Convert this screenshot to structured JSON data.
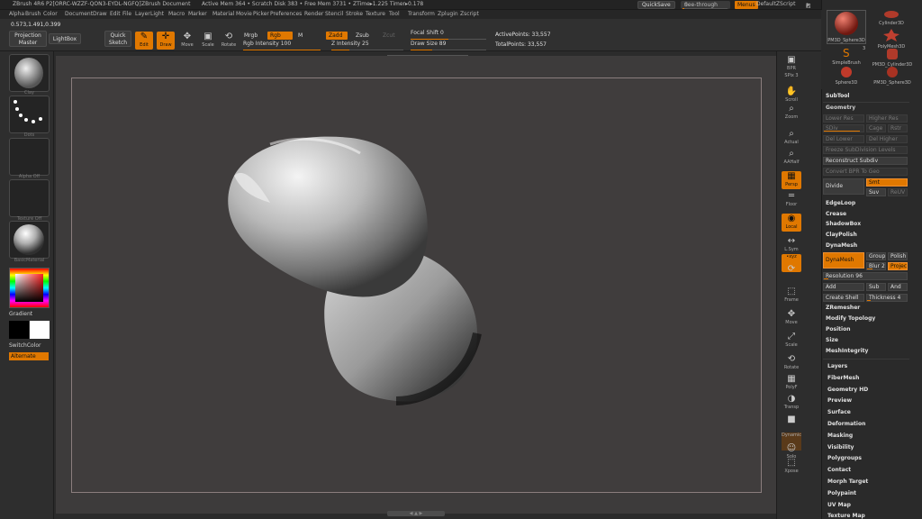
{
  "title": {
    "app": "ZBrush 4R6 P2[ORRC-WZZF-QON3-EYDL-NGFQ]",
    "doc": "ZBrush Document",
    "mem": "Active Mem 364 • Scratch Disk 383 • Free Mem 3731 • ZTime▸1.225 Timer▸0.178",
    "quicksave": "QuickSave",
    "seethrough": "See-through",
    "seethrough_value": "0",
    "seethrough_fraction": 0.0,
    "menus": "Menus",
    "script": "DefaultZScript"
  },
  "menubar": [
    "Alpha",
    "Brush",
    "Color",
    "Document",
    "Draw",
    "Edit",
    "File",
    "Layer",
    "Light",
    "Macro",
    "Marker",
    "Material",
    "Movie",
    "Picker",
    "Preferences",
    "Render",
    "Stencil",
    "Stroke",
    "Texture",
    "Tool",
    "Transform",
    "Zplugin",
    "Zscript"
  ],
  "topshelf": {
    "coords": "0.573,1.491,0.399",
    "projection_master": "Projection Master",
    "lightbox": "LightBox",
    "quick_sketch": "Quick Sketch",
    "edit": "Edit",
    "draw": "Draw",
    "move": "Move",
    "scale": "Scale",
    "rotate": "Rotate",
    "mrgb": "Mrgb",
    "rgb": "Rgb",
    "m": "M",
    "rgb_intensity_label": "Rgb Intensity 100",
    "rgb_intensity": 100,
    "zadd": "Zadd",
    "zsub": "Zsub",
    "zcut": "Zcut",
    "z_intensity_label": "Z Intensity 25",
    "z_intensity": 25,
    "focal_shift_label": "Focal Shift 0",
    "focal_shift": 0,
    "draw_size_label": "Draw Size 89",
    "draw_size": 89,
    "active_points": "ActivePoints: 33,557",
    "total_points": "TotalPoints: 33,557"
  },
  "leftshelf": {
    "thumb_labels": [
      "Clay",
      "Dots",
      "Alpha Off",
      "Texture Off",
      "BasicMaterial"
    ],
    "gradient": "Gradient",
    "switchcolor": "SwitchColor",
    "alternate": "Alternate",
    "main_color": "#000000",
    "secondary_color": "#ffffff"
  },
  "rightshelf": [
    {
      "name": "bpr",
      "label": "BPR",
      "glyph": "▣"
    },
    {
      "name": "spix",
      "label": "SPix 3",
      "glyph": ""
    },
    {
      "name": "scroll",
      "label": "Scroll",
      "glyph": "✋"
    },
    {
      "name": "zoom",
      "label": "Zoom",
      "glyph": "⌕"
    },
    {
      "name": "actual",
      "label": "Actual",
      "glyph": "⌕"
    },
    {
      "name": "aahalf",
      "label": "AAHalf",
      "glyph": "⌕"
    },
    {
      "name": "persp",
      "label": "Persp",
      "glyph": "▦"
    },
    {
      "name": "floor",
      "label": "Floor",
      "glyph": "═"
    },
    {
      "name": "local",
      "label": "Local",
      "glyph": "◉"
    },
    {
      "name": "lsym",
      "label": "L.Sym",
      "glyph": "↔"
    },
    {
      "name": "xyz",
      "label": "•xyz",
      "glyph": ""
    },
    {
      "name": "rotate-y",
      "label": "",
      "glyph": "⟳"
    },
    {
      "name": "frame",
      "label": "Frame",
      "glyph": "⬚"
    },
    {
      "name": "move",
      "label": "Move",
      "glyph": "✥"
    },
    {
      "name": "scale",
      "label": "Scale",
      "glyph": "⤢"
    },
    {
      "name": "rotate",
      "label": "Rotate",
      "glyph": "⟲"
    },
    {
      "name": "polyf",
      "label": "PolyF",
      "glyph": "▦"
    },
    {
      "name": "transp",
      "label": "Transp",
      "glyph": "◑"
    },
    {
      "name": "ghost",
      "label": "",
      "glyph": "■"
    },
    {
      "name": "dynamic",
      "label": "Dynamic",
      "glyph": ""
    },
    {
      "name": "solo",
      "label": "Solo",
      "glyph": "☺"
    },
    {
      "name": "xpose",
      "label": "Xpose",
      "glyph": "⬚"
    }
  ],
  "tray": {
    "tool_thumbs": [
      {
        "label": "PM3D_Sphere3D"
      },
      {
        "label": "Cylinder3D"
      },
      {
        "label": "PolyMesh3D"
      },
      {
        "label": "SimpleBrush"
      },
      {
        "label": "PM3D_Cylinder3D"
      },
      {
        "label": "Sphere3D"
      },
      {
        "label": "PM3D_Sphere3D"
      }
    ],
    "tool_count": "3",
    "subtool": "SubTool",
    "geometry": "Geometry",
    "lower_res": "Lower Res",
    "higher_res": "Higher Res",
    "sdiv": "SDiv",
    "cage": "Cage",
    "rstr": "Rstr",
    "del_lower": "Del Lower",
    "del_higher": "Del Higher",
    "freeze_subdiv": "Freeze SubDivision Levels",
    "reconstruct_subdiv": "Reconstruct Subdiv",
    "convert_bpr": "Convert BPR To Geo",
    "divide": "Divide",
    "smt": "Smt",
    "suv": "Suv",
    "reuv": "ReUV",
    "edgeloop": "EdgeLoop",
    "crease": "Crease",
    "shadowbox": "ShadowBox",
    "claypolish": "ClayPolish",
    "dynamesh_section": "DynaMesh",
    "dynamesh_btn": "DynaMesh",
    "groups": "Groups",
    "polish": "Polish",
    "blur": "Blur 2",
    "project": "Project",
    "resolution_label": "Resolution 96",
    "resolution": 96,
    "add": "Add",
    "sub": "Sub",
    "and": "And",
    "create_shell": "Create Shell",
    "thickness_label": "Thickness 4",
    "thickness": 4,
    "sections": [
      "ZRemesher",
      "Modify Topology",
      "Position",
      "Size",
      "MeshIntegrity"
    ],
    "menus": [
      "Layers",
      "FiberMesh",
      "Geometry HD",
      "Preview",
      "Surface",
      "Deformation",
      "Masking",
      "Visibility",
      "Polygroups",
      "Contact",
      "Morph Target",
      "Polypaint",
      "UV Map",
      "Texture Map"
    ]
  },
  "colors": {
    "accent": "#e07800",
    "background": "#2b2b2b",
    "canvas": "#3d3b3b",
    "document_border": "#8a7d7d"
  }
}
